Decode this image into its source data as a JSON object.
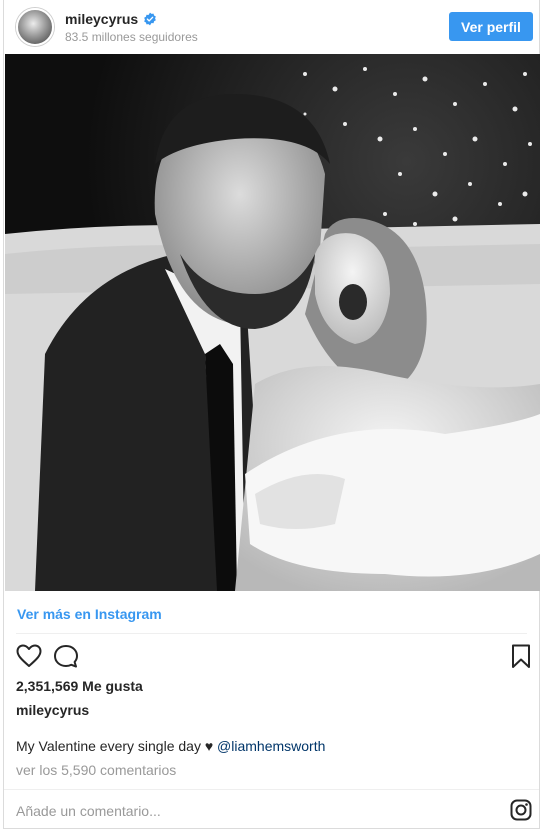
{
  "header": {
    "username": "mileycyrus",
    "followers": "83.5 millones seguidores",
    "profile_button": "Ver perfil"
  },
  "post": {
    "more_link": "Ver más en Instagram",
    "likes": "2,351,569 Me gusta",
    "caption_user": "mileycyrus",
    "caption_text": "My Valentine every single day",
    "caption_heart": "♥",
    "caption_mention": "@liamhemsworth",
    "comments_link": "ver los 5,590 comentarios",
    "comment_placeholder": "Añade un comentario..."
  },
  "icons": {
    "verified": "verified-badge-icon",
    "like": "heart-icon",
    "comment": "comment-bubble-icon",
    "save": "bookmark-icon",
    "brand": "instagram-logo-icon"
  },
  "colors": {
    "accent": "#3897f0",
    "mention": "#003569",
    "muted": "#999999",
    "text": "#262626"
  }
}
